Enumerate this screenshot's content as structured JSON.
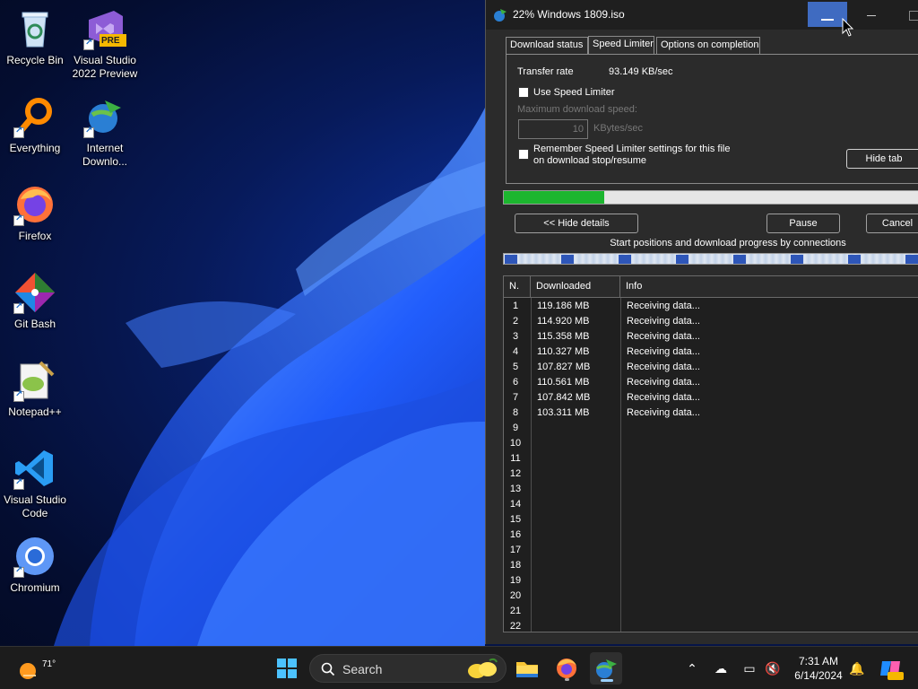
{
  "desktop": {
    "icons": [
      {
        "label": "Recycle Bin",
        "icon": "recycle-bin-icon"
      },
      {
        "label": "Visual Studio 2022 Preview",
        "icon": "visual-studio-preview-icon",
        "badge": "PRE"
      },
      {
        "label": "Everything",
        "icon": "everything-search-icon"
      },
      {
        "label": "Internet Downlo...",
        "icon": "internet-download-manager-icon"
      },
      {
        "label": "Firefox",
        "icon": "firefox-icon"
      },
      {
        "label": "Git Bash",
        "icon": "git-bash-icon"
      },
      {
        "label": "Notepad++",
        "icon": "notepad-plus-plus-icon"
      },
      {
        "label": "Visual Studio Code",
        "icon": "vscode-icon"
      },
      {
        "label": "Chromium",
        "icon": "chromium-icon"
      }
    ]
  },
  "window": {
    "title": "22% Windows 1809.iso",
    "progress_fraction": 0.24,
    "tabs": [
      {
        "label": "Download status",
        "active": false
      },
      {
        "label": "Speed Limiter",
        "active": true
      },
      {
        "label": "Options on completion",
        "active": false
      }
    ],
    "speed_limiter": {
      "transfer_rate_label": "Transfer rate",
      "transfer_rate_value": "93.149  KB/sec",
      "use_speed_limiter_label": "Use Speed Limiter",
      "use_speed_limiter_checked": false,
      "max_speed_label": "Maximum download speed:",
      "max_speed_value": "10",
      "max_speed_unit": "KBytes/sec",
      "remember_label_line1": "Remember Speed Limiter settings for this file",
      "remember_label_line2": "on download stop/resume",
      "remember_checked": false,
      "hide_tab_label": "Hide tab"
    },
    "buttons": {
      "hide_details": "<< Hide details",
      "pause": "Pause",
      "cancel": "Cancel"
    },
    "connections_label": "Start positions and download progress by connections",
    "table": {
      "headers": [
        "N.",
        "Downloaded",
        "Info"
      ],
      "rows": [
        {
          "n": "1",
          "downloaded": "119.186  MB",
          "info": "Receiving data..."
        },
        {
          "n": "2",
          "downloaded": "114.920  MB",
          "info": "Receiving data..."
        },
        {
          "n": "3",
          "downloaded": "115.358  MB",
          "info": "Receiving data..."
        },
        {
          "n": "4",
          "downloaded": "110.327  MB",
          "info": "Receiving data..."
        },
        {
          "n": "5",
          "downloaded": "107.827  MB",
          "info": "Receiving data..."
        },
        {
          "n": "6",
          "downloaded": "110.561  MB",
          "info": "Receiving data..."
        },
        {
          "n": "7",
          "downloaded": "107.842  MB",
          "info": "Receiving data..."
        },
        {
          "n": "8",
          "downloaded": "103.311  MB",
          "info": "Receiving data..."
        },
        {
          "n": "9",
          "downloaded": "",
          "info": ""
        },
        {
          "n": "10",
          "downloaded": "",
          "info": ""
        },
        {
          "n": "11",
          "downloaded": "",
          "info": ""
        },
        {
          "n": "12",
          "downloaded": "",
          "info": ""
        },
        {
          "n": "13",
          "downloaded": "",
          "info": ""
        },
        {
          "n": "14",
          "downloaded": "",
          "info": ""
        },
        {
          "n": "15",
          "downloaded": "",
          "info": ""
        },
        {
          "n": "16",
          "downloaded": "",
          "info": ""
        },
        {
          "n": "17",
          "downloaded": "",
          "info": ""
        },
        {
          "n": "18",
          "downloaded": "",
          "info": ""
        },
        {
          "n": "19",
          "downloaded": "",
          "info": ""
        },
        {
          "n": "20",
          "downloaded": "",
          "info": ""
        },
        {
          "n": "21",
          "downloaded": "",
          "info": ""
        },
        {
          "n": "22",
          "downloaded": "",
          "info": ""
        }
      ]
    }
  },
  "taskbar": {
    "weather_temp": "71°",
    "search_placeholder": "Search",
    "clock_time": "7:31 AM",
    "clock_date": "6/14/2024",
    "pinned": [
      "windows-start-icon",
      "file-explorer-icon",
      "firefox-icon",
      "internet-download-manager-icon"
    ],
    "tray": [
      "chevron-up-icon",
      "onedrive-icon",
      "network-icon",
      "volume-mute-icon",
      "notification-bell-icon",
      "copilot-icon"
    ]
  },
  "colors": {
    "accent": "#3f6bc1",
    "progress_green": "#1cb62f",
    "connection_blue": "#2e56b8"
  }
}
